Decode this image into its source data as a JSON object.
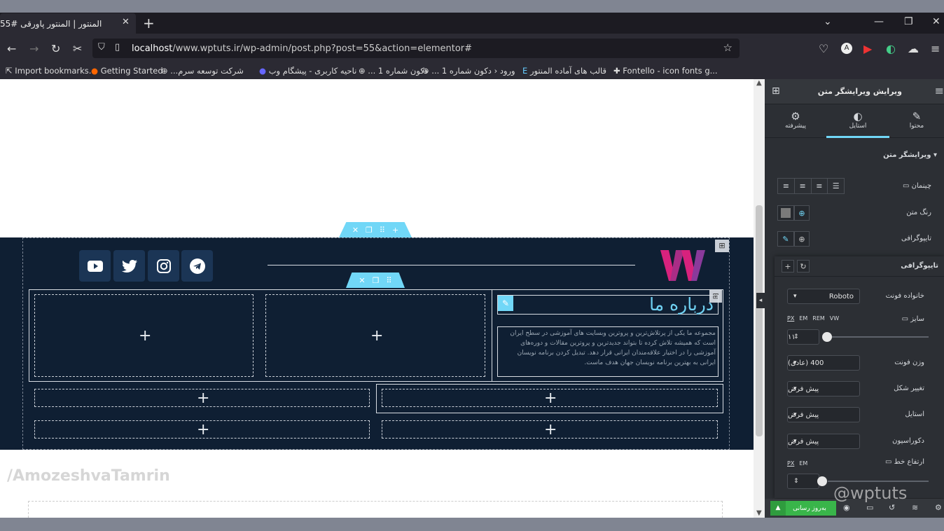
{
  "browser": {
    "tab_title": "المنتور | المنتور پاورقی #55",
    "url_host": "localhost",
    "url_path": "/www.wptuts.ir/wp-admin/post.php?post=55&action=elementor#",
    "bookmarks": [
      {
        "label": "Import bookmarks..."
      },
      {
        "label": "Getting Started"
      },
      {
        "label": "شرکت توسعه سرم..."
      },
      {
        "label": "ناحیه کاربری - پیشگام وب"
      },
      {
        "label": "دکون شماره 1 ..."
      },
      {
        "label": "ورود ‹ دکون شماره 1 ..."
      },
      {
        "label": "قالب های آماده المنتور"
      },
      {
        "label": "Fontello - icon fonts g..."
      }
    ]
  },
  "canvas": {
    "heading": "درباره ما",
    "paragraph": "مجموعه ما یکی از پرتلاش‌ترین و پروترین وبسایت های آموزشی در سطح ایران است که همیشه تلاش کرده تا بتواند جدیدترین و پروترین مقالات و دوره‌های آموزشی را در اختیار علاقه‌مندان ایرانی قرار دهد. تبدیل کردن برنامه نویسان ایرانی به بهترین برنامه نویسان جهان هدف ماست.",
    "plus": "+",
    "watermark_left": "/AmozeshvaTamrin",
    "watermark_right": "@wptuts"
  },
  "panel": {
    "title": "ویرایش ویرایشگر متن",
    "tabs": [
      {
        "label": "محتوا"
      },
      {
        "label": "استایل"
      },
      {
        "label": "پیشرفته"
      }
    ],
    "section_title": "ویرایشگر متن",
    "alignment_label": "چینمان",
    "text_color_label": "رنگ متن",
    "typography_label": "تایپوگرافی",
    "typography_popup_title": "تایپوگرافی",
    "font_family_label": "خانواده فونت",
    "font_family_value": "Roboto",
    "size_label": "سایز",
    "size_units": [
      "PX",
      "EM",
      "REM",
      "VW"
    ],
    "size_value": "۱۱",
    "font_weight_label": "وزن فونت",
    "font_weight_value": "400 (عادی)",
    "transform_label": "تغییر شکل",
    "transform_value": "پیش فرض",
    "style_label": "استایل",
    "style_value": "پیش فرض",
    "decoration_label": "دکوراسیون",
    "decoration_value": "پیش فرض",
    "line_height_label": "ارتفاع خط",
    "line_height_units": [
      "PX",
      "EM"
    ],
    "update_button": "به‌روز رسانی"
  },
  "colors": {
    "dark_section": "#0f1f33",
    "accent_cyan": "#71d7f7",
    "update_green": "#39b54a",
    "logo_pink": "#d7227d"
  }
}
